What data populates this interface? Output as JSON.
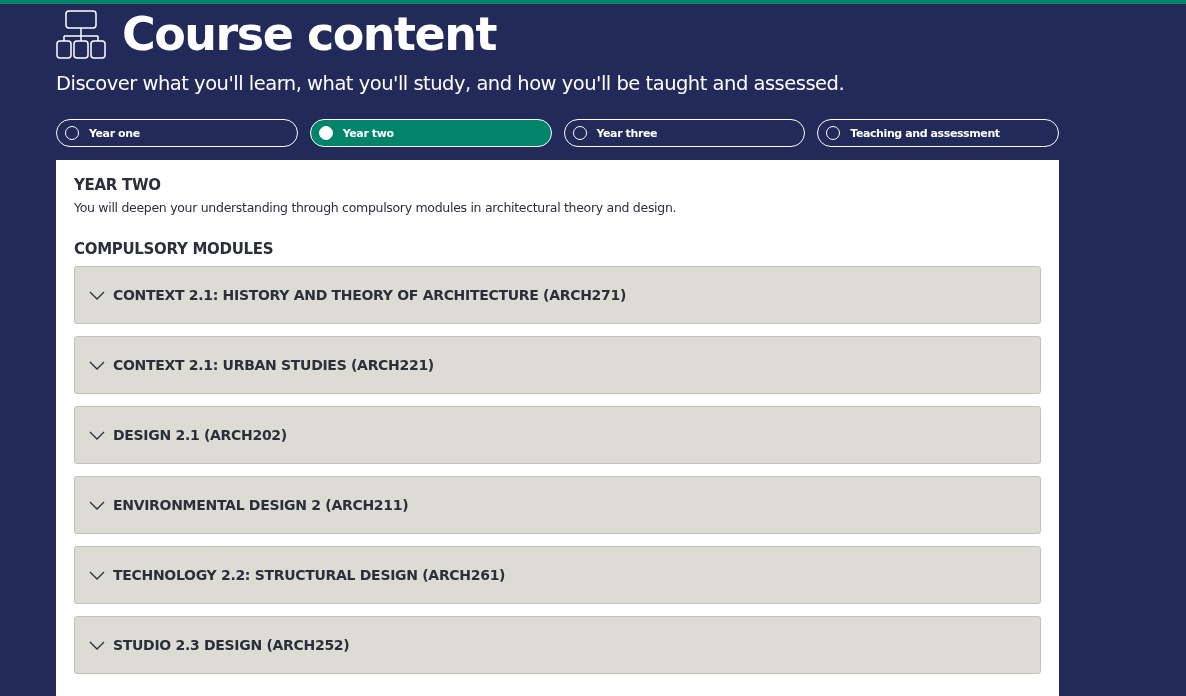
{
  "header": {
    "title": "Course content",
    "subtitle": "Discover what you'll learn, what you'll study, and how you'll be taught and assessed."
  },
  "tabs": [
    {
      "label": "Year one",
      "selected": false
    },
    {
      "label": "Year two",
      "selected": true
    },
    {
      "label": "Year three",
      "selected": false
    },
    {
      "label": "Teaching and assessment",
      "selected": false
    }
  ],
  "panel": {
    "heading": "YEAR TWO",
    "description": "You will deepen your understanding through compulsory modules in architectural theory and design.",
    "section_heading": "COMPULSORY MODULES",
    "modules": [
      {
        "title": "CONTEXT 2.1: HISTORY AND THEORY OF ARCHITECTURE (ARCH271)",
        "expanded": false
      },
      {
        "title": "CONTEXT 2.1: URBAN STUDIES (ARCH221)",
        "expanded": false
      },
      {
        "title": "DESIGN 2.1 (ARCH202)",
        "expanded": false
      },
      {
        "title": "ENVIRONMENTAL DESIGN 2 (ARCH211)",
        "expanded": false
      },
      {
        "title": "TECHNOLOGY 2.2: STRUCTURAL DESIGN (ARCH261)",
        "expanded": false
      },
      {
        "title": "STUDIO 2.3 DESIGN (ARCH252)",
        "expanded": false
      }
    ]
  }
}
